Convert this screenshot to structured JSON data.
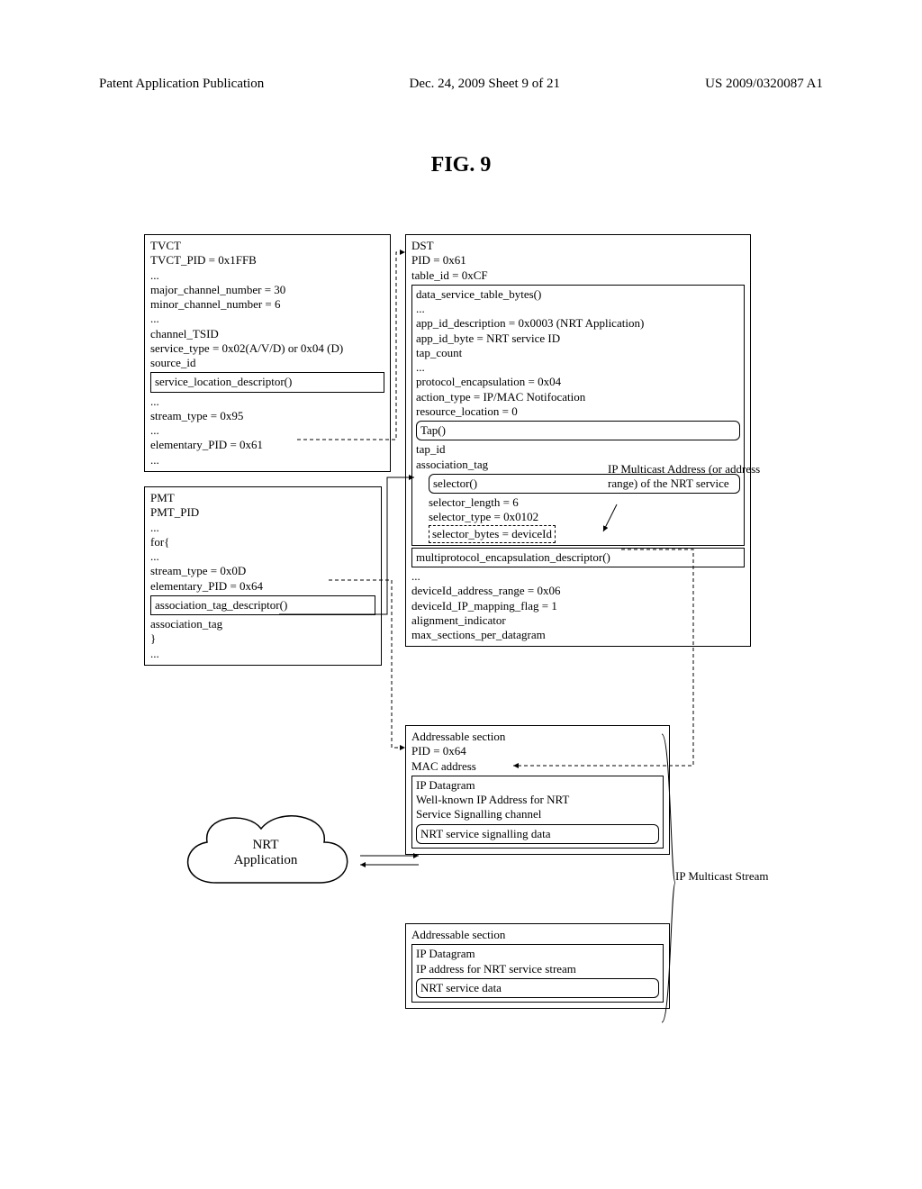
{
  "header": {
    "left": "Patent Application Publication",
    "center": "Dec. 24, 2009  Sheet 9 of 21",
    "right": "US 2009/0320087 A1"
  },
  "figure_title": "FIG. 9",
  "tvct": {
    "title": "TVCT",
    "lines": [
      "TVCT_PID = 0x1FFB",
      "...",
      "major_channel_number = 30",
      "minor_channel_number = 6",
      "...",
      "channel_TSID",
      "service_type = 0x02(A/V/D) or 0x04 (D)",
      "source_id"
    ],
    "desc_title": "service_location_descriptor()",
    "desc_lines": [
      "...",
      "stream_type = 0x95",
      "...",
      "elementary_PID = 0x61",
      "..."
    ]
  },
  "pmt": {
    "title": "PMT",
    "lines": [
      "PMT_PID",
      "...",
      "for{",
      "   ...",
      "   stream_type = 0x0D",
      "   elementary_PID = 0x64"
    ],
    "desc_title": "association_tag_descriptor()",
    "desc_lines": [
      "association_tag",
      "  }",
      "..."
    ]
  },
  "dst": {
    "title": "DST",
    "header_lines": [
      "PID = 0x61",
      "table_id = 0xCF"
    ],
    "block1": [
      "data_service_table_bytes()",
      "...",
      "app_id_description = 0x0003 (NRT Application)",
      "app_id_byte = NRT service ID",
      "tap_count",
      "...",
      "protocol_encapsulation = 0x04",
      "action_type = IP/MAC Notifocation",
      "resource_location = 0"
    ],
    "tap_title": "Tap()",
    "tap_lines": [
      "tap_id",
      "association_tag"
    ],
    "selector_title": "selector()",
    "selector_lines": [
      "selector_length = 6",
      "selector_type = 0x0102",
      "selector_bytes = deviceId"
    ],
    "mpe_title": "multiprotocol_encapsulation_descriptor()",
    "mpe_lines": [
      "...",
      "deviceId_address_range = 0x06",
      "deviceId_IP_mapping_flag = 1",
      "alignment_indicator",
      "max_sections_per_datagram"
    ]
  },
  "addr1": {
    "title": "Addressable section",
    "lines": [
      "PID = 0x64",
      "MAC address"
    ],
    "ipd": [
      "IP Datagram",
      "Well-known IP Address for NRT",
      "Service Signalling channel"
    ],
    "inner_box": "NRT service signalling data"
  },
  "addr2": {
    "title": "Addressable section",
    "ipd": [
      "IP Datagram",
      "IP address for NRT service stream"
    ],
    "inner_box": "NRT service data"
  },
  "cloud": {
    "line1": "NRT",
    "line2": "Application"
  },
  "annot": {
    "ip": "IP Multicast Address (or address range) of the NRT service",
    "stream": "IP Multicast Stream"
  }
}
